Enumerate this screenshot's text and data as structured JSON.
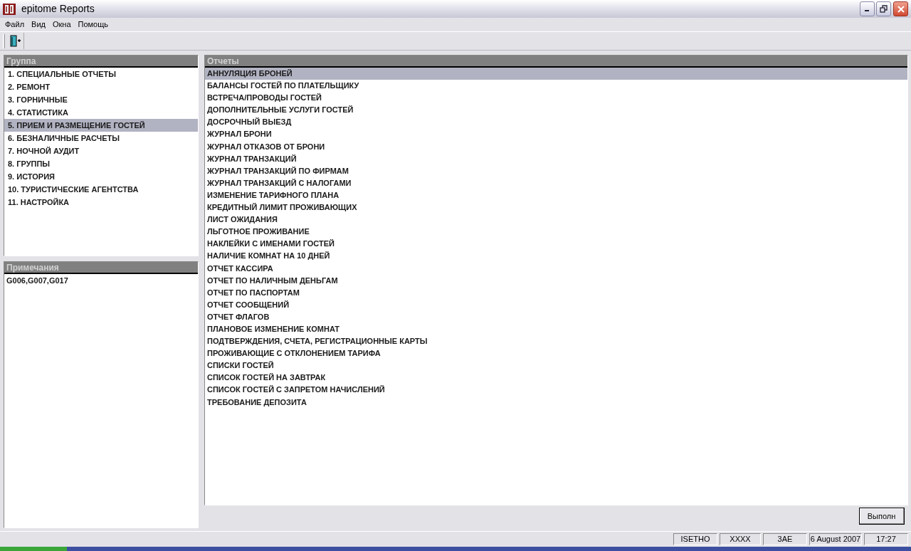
{
  "window": {
    "title": "epitome Reports"
  },
  "menu": [
    "Файл",
    "Вид",
    "Окна",
    "Помощь"
  ],
  "groups": {
    "header": "Группа",
    "items": [
      {
        "label": "1. СПЕЦИАЛЬНЫЕ ОТЧЕТЫ",
        "selected": false
      },
      {
        "label": "2. РЕМОНТ",
        "selected": false
      },
      {
        "label": "3. ГОРНИЧНЫЕ",
        "selected": false
      },
      {
        "label": "4. СТАТИСТИКА",
        "selected": false
      },
      {
        "label": "5. ПРИЕМ И РАЗМЕЩЕНИЕ ГОСТЕЙ",
        "selected": true
      },
      {
        "label": "6. БЕЗНАЛИЧНЫЕ РАСЧЕТЫ",
        "selected": false
      },
      {
        "label": "7. НОЧНОЙ АУДИТ",
        "selected": false
      },
      {
        "label": "8. ГРУППЫ",
        "selected": false
      },
      {
        "label": "9. ИСТОРИЯ",
        "selected": false
      },
      {
        "label": "10. ТУРИСТИЧЕСКИЕ АГЕНТСТВА",
        "selected": false
      },
      {
        "label": "11. НАСТРОЙКА",
        "selected": false
      }
    ]
  },
  "notes": {
    "header": "Примечания",
    "text": "G006,G007,G017"
  },
  "reports": {
    "header": "Отчеты",
    "items": [
      {
        "label": "АННУЛЯЦИЯ БРОНЕЙ",
        "selected": true
      },
      {
        "label": "БАЛАНСЫ ГОСТЕЙ ПО ПЛАТЕЛЬЩИКУ",
        "selected": false
      },
      {
        "label": "ВСТРЕЧА/ПРОВОДЫ ГОСТЕЙ",
        "selected": false
      },
      {
        "label": "ДОПОЛНИТЕЛЬНЫЕ УСЛУГИ ГОСТЕЙ",
        "selected": false
      },
      {
        "label": "ДОСРОЧНЫЙ ВЫЕЗД",
        "selected": false
      },
      {
        "label": "ЖУРНАЛ БРОНИ",
        "selected": false
      },
      {
        "label": "ЖУРНАЛ ОТКАЗОВ ОТ БРОНИ",
        "selected": false
      },
      {
        "label": "ЖУРНАЛ ТРАНЗАКЦИЙ",
        "selected": false
      },
      {
        "label": "ЖУРНАЛ ТРАНЗАКЦИЙ ПО ФИРМАМ",
        "selected": false
      },
      {
        "label": "ЖУРНАЛ ТРАНЗАКЦИЙ С НАЛОГАМИ",
        "selected": false
      },
      {
        "label": "ИЗМЕНЕНИЕ ТАРИФНОГО ПЛАНА",
        "selected": false
      },
      {
        "label": "КРЕДИТНЫЙ ЛИМИТ ПРОЖИВАЮЩИХ",
        "selected": false
      },
      {
        "label": "ЛИСТ ОЖИДАНИЯ",
        "selected": false
      },
      {
        "label": "ЛЬГОТНОЕ ПРОЖИВАНИЕ",
        "selected": false
      },
      {
        "label": "НАКЛЕЙКИ С ИМЕНАМИ ГОСТЕЙ",
        "selected": false
      },
      {
        "label": "НАЛИЧИЕ КОМНАТ НА 10 ДНЕЙ",
        "selected": false
      },
      {
        "label": "ОТЧЕТ КАССИРА",
        "selected": false
      },
      {
        "label": "ОТЧЕТ ПО НАЛИЧНЫМ ДЕНЬГАМ",
        "selected": false
      },
      {
        "label": "ОТЧЕТ ПО ПАСПОРТАМ",
        "selected": false
      },
      {
        "label": "ОТЧЕТ СООБЩЕНИЙ",
        "selected": false
      },
      {
        "label": "ОТЧЕТ ФЛАГОВ",
        "selected": false
      },
      {
        "label": "ПЛАНОВОЕ ИЗМЕНЕНИЕ КОМНАТ",
        "selected": false
      },
      {
        "label": "ПОДТВЕРЖДЕНИЯ, СЧЕТА, РЕГИСТРАЦИОННЫЕ КАРТЫ",
        "selected": false
      },
      {
        "label": "ПРОЖИВАЮЩИЕ С ОТКЛОНЕНИЕМ ТАРИФА",
        "selected": false
      },
      {
        "label": "СПИСКИ ГОСТЕЙ",
        "selected": false
      },
      {
        "label": "СПИСОК ГОСТЕЙ НА ЗАВТРАК",
        "selected": false
      },
      {
        "label": "СПИСОК ГОСТЕЙ С ЗАПРЕТОМ НАЧИСЛЕНИЙ",
        "selected": false
      },
      {
        "label": "ТРЕБОВАНИЕ ДЕПОЗИТА",
        "selected": false
      }
    ]
  },
  "run_button": "Выполн",
  "status_bar": [
    "ISETHO",
    "XXXX",
    "3AE",
    "6 August 2007",
    "17:27"
  ]
}
